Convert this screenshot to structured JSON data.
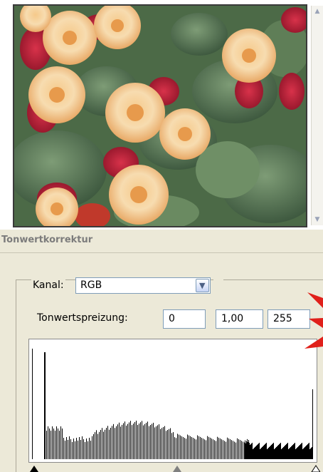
{
  "photo": {
    "description_icon": "photo-begonias"
  },
  "dialog": {
    "title": "Tonwertkorrektur",
    "channel_label": "Kanal:",
    "channel_value": "RGB",
    "input_levels_label": "Tonwertspreizung:",
    "input_black": "0",
    "input_gamma": "1,00",
    "input_white": "255"
  },
  "colors": {
    "dialog_bg": "#ece9d8",
    "field_border": "#7f9db9",
    "annotation_arrow": "#e0201a",
    "histogram": "#000000"
  },
  "histogram": {
    "levels_note": "256-level luminance histogram",
    "black_point": 0,
    "gamma": 1.0,
    "white_point": 255
  }
}
